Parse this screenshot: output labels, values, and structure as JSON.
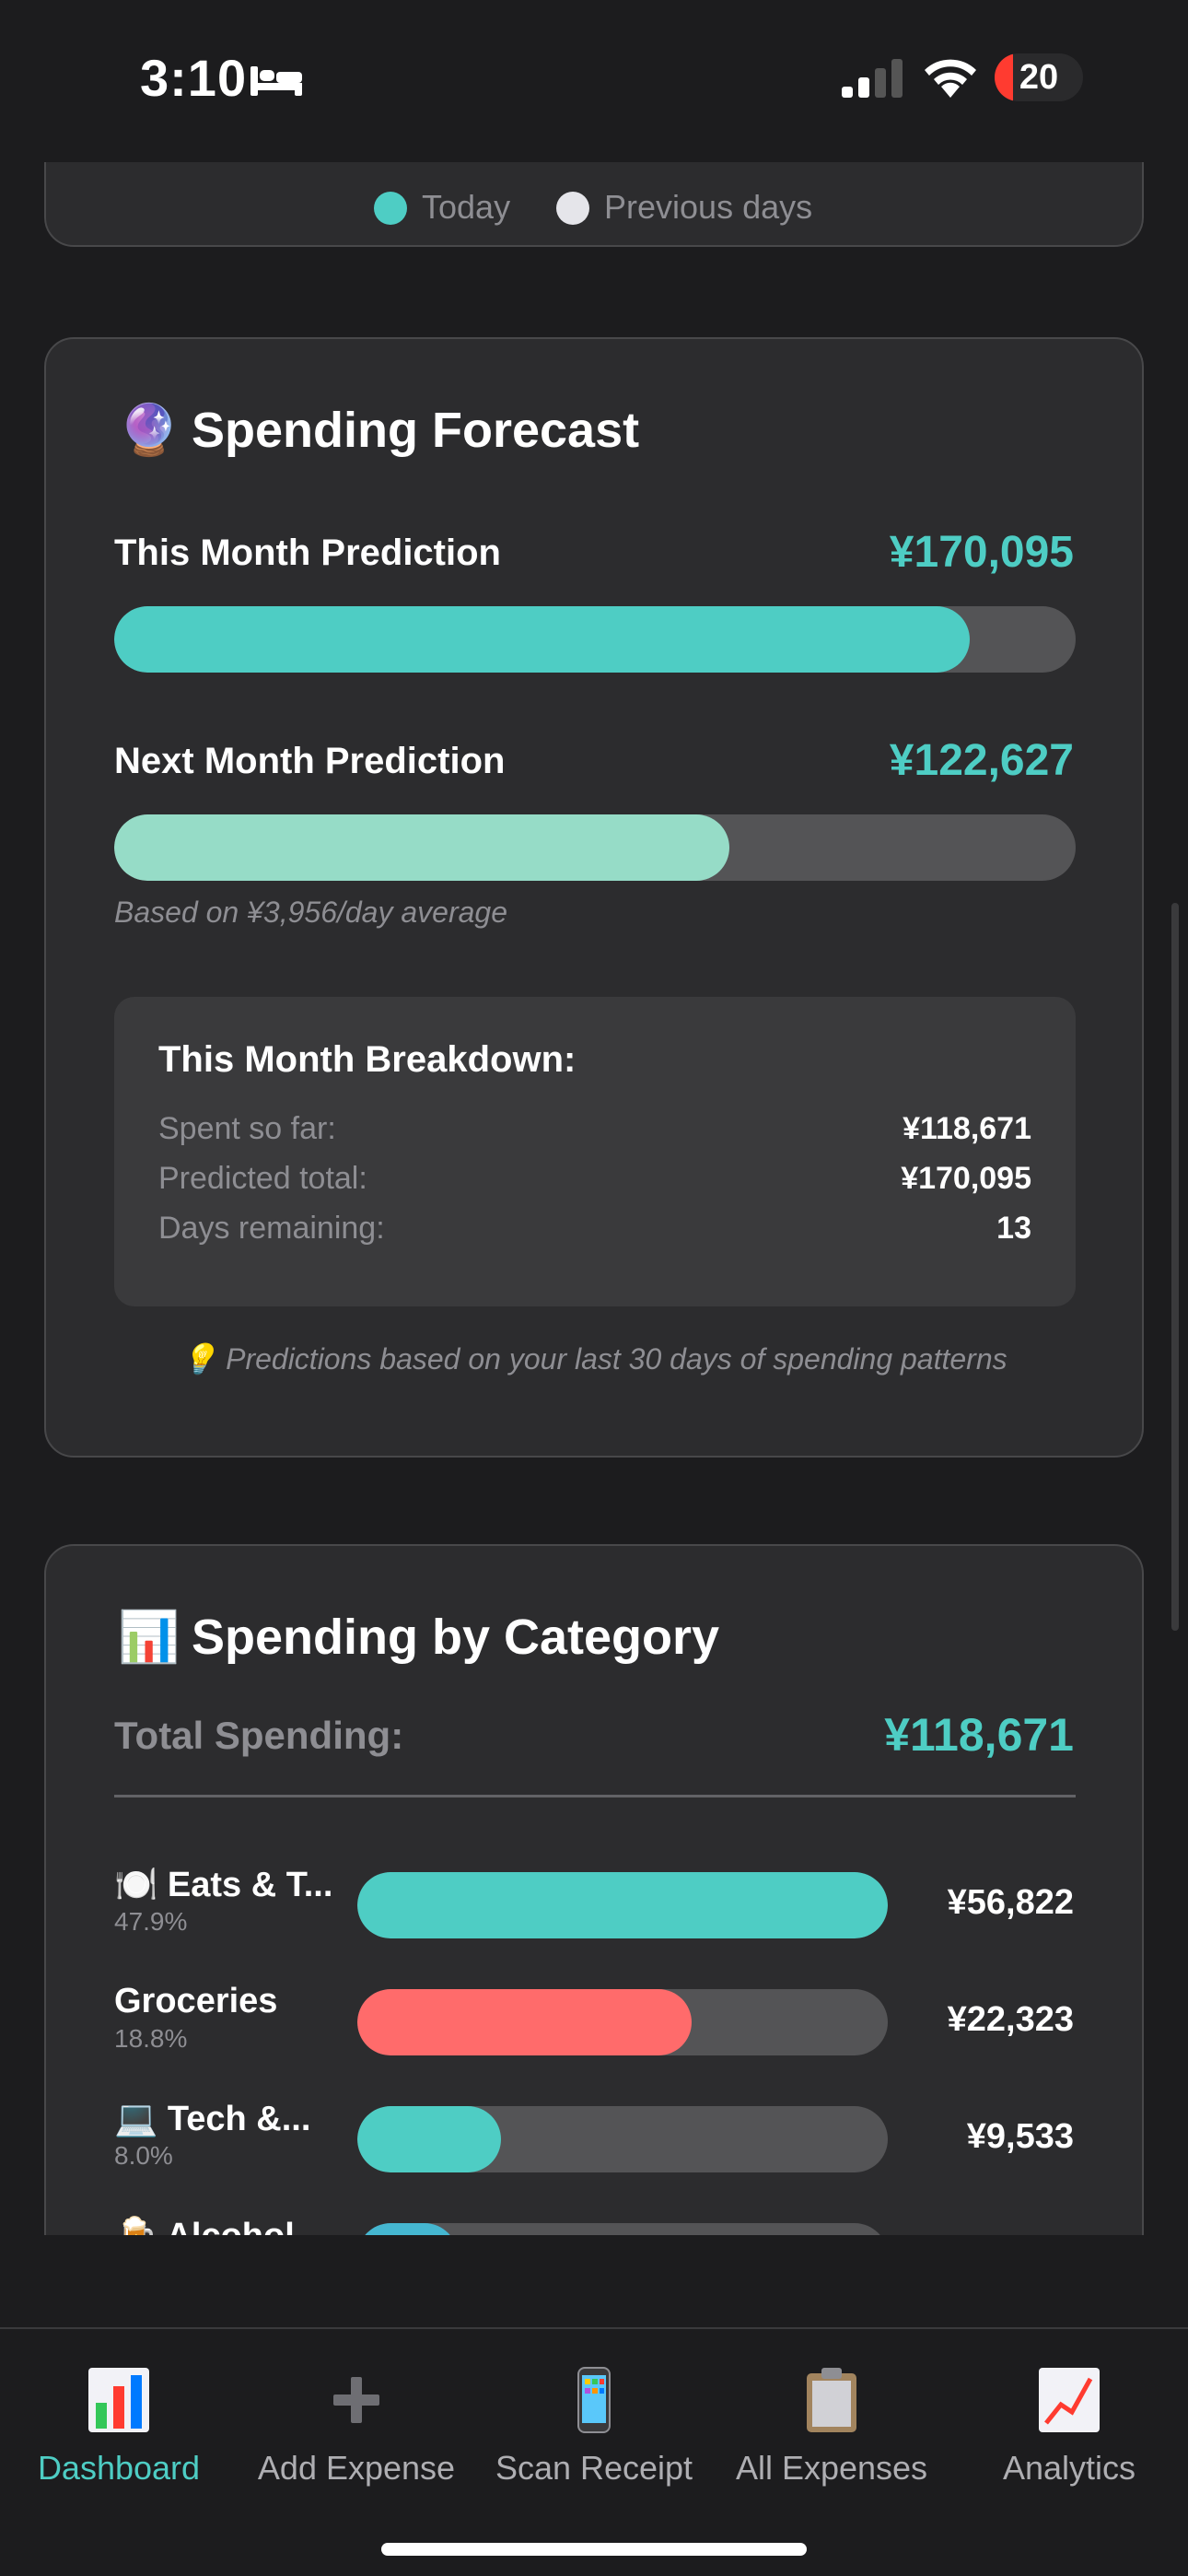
{
  "status": {
    "time": "3:10",
    "battery": "20"
  },
  "legend": {
    "today": "Today",
    "previous": "Previous days"
  },
  "forecast": {
    "emoji": "🔮",
    "title": "Spending Forecast",
    "this_month_label": "This Month Prediction",
    "this_month_value": "¥170,095",
    "this_month_progress": 0.89,
    "next_month_label": "Next Month Prediction",
    "next_month_value": "¥122,627",
    "next_month_progress": 0.64,
    "basis_note": "Based on ¥3,956/day average",
    "breakdown": {
      "title": "This Month Breakdown:",
      "rows": [
        {
          "label": "Spent so far:",
          "value": "¥118,671"
        },
        {
          "label": "Predicted total:",
          "value": "¥170,095"
        },
        {
          "label": "Days remaining:",
          "value": "13"
        }
      ]
    },
    "tip": "💡 Predictions based on your last 30 days of spending patterns"
  },
  "category": {
    "emoji": "📊",
    "title": "Spending by Category",
    "total_label": "Total Spending:",
    "total_value": "¥118,671",
    "items": [
      {
        "name": "🍽️ Eats & T...",
        "pct": "47.9%",
        "amount": "¥56,822",
        "fill": 1.0,
        "color": "#4ecdc4"
      },
      {
        "name": "Groceries",
        "pct": "18.8%",
        "amount": "¥22,323",
        "fill": 0.63,
        "color": "#ff6b6b"
      },
      {
        "name": "💻 Tech &...",
        "pct": "8.0%",
        "amount": "¥9,533",
        "fill": 0.27,
        "color": "#4ecdc4"
      },
      {
        "name": "🍺 Alcohol",
        "pct": "",
        "amount": "",
        "fill": 0.19,
        "color": "#45b7d1"
      }
    ]
  },
  "tabs": [
    {
      "label": "Dashboard",
      "icon": "bar-chart-icon",
      "active": true
    },
    {
      "label": "Add Expense",
      "icon": "plus-icon",
      "active": false
    },
    {
      "label": "Scan Receipt",
      "icon": "phone-icon",
      "active": false
    },
    {
      "label": "All Expenses",
      "icon": "clipboard-icon",
      "active": false
    },
    {
      "label": "Analytics",
      "icon": "trend-chart-icon",
      "active": false
    }
  ],
  "colors": {
    "accent": "#4ecdc4",
    "next_month_bar": "#96dcc7",
    "groceries": "#ff6b6b"
  }
}
